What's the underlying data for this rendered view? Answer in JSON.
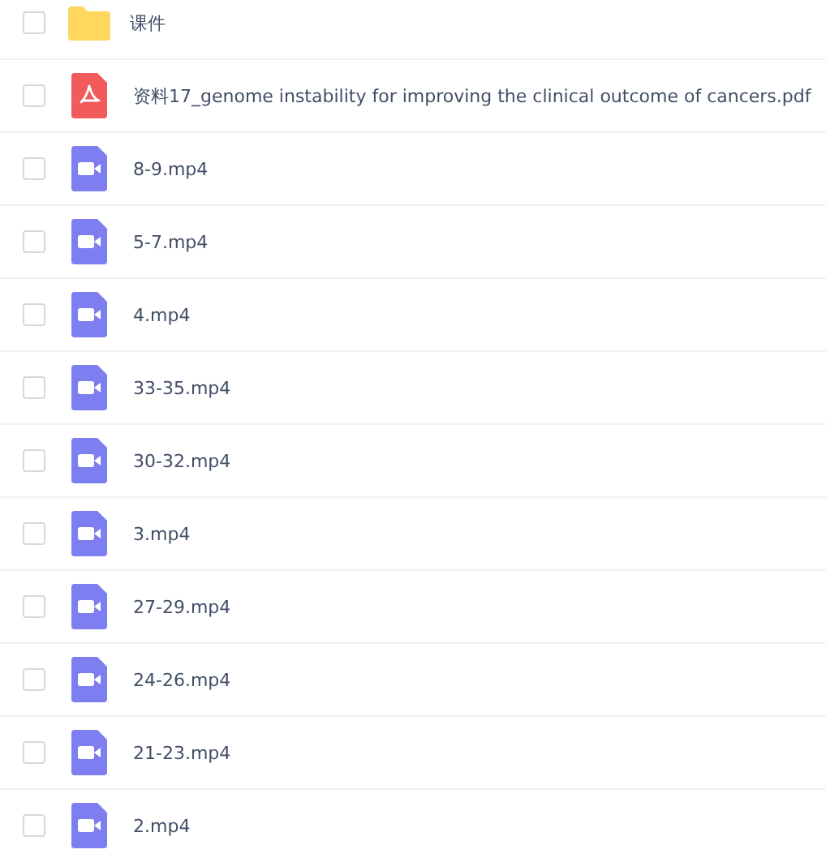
{
  "files": [
    {
      "kind": "folder",
      "name": "课件",
      "checked": false
    },
    {
      "kind": "pdf",
      "name": "资料17_genome instability for improving the clinical outcome of cancers.pdf",
      "checked": false
    },
    {
      "kind": "video",
      "name": "8-9.mp4",
      "checked": false
    },
    {
      "kind": "video",
      "name": "5-7.mp4",
      "checked": false
    },
    {
      "kind": "video",
      "name": "4.mp4",
      "checked": false
    },
    {
      "kind": "video",
      "name": "33-35.mp4",
      "checked": false
    },
    {
      "kind": "video",
      "name": "30-32.mp4",
      "checked": false
    },
    {
      "kind": "video",
      "name": "3.mp4",
      "checked": false
    },
    {
      "kind": "video",
      "name": "27-29.mp4",
      "checked": false
    },
    {
      "kind": "video",
      "name": "24-26.mp4",
      "checked": false
    },
    {
      "kind": "video",
      "name": "21-23.mp4",
      "checked": false
    },
    {
      "kind": "video",
      "name": "2.mp4",
      "checked": false
    }
  ]
}
